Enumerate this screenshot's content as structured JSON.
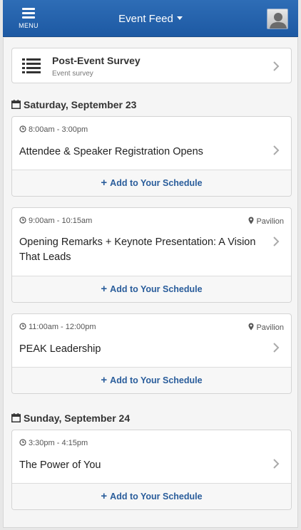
{
  "header": {
    "menu_label": "MENU",
    "feed_title": "Event Feed"
  },
  "survey": {
    "title": "Post-Event Survey",
    "subtitle": "Event survey"
  },
  "days": [
    {
      "label": "Saturday, September 23",
      "sessions": [
        {
          "time": "8:00am - 3:00pm",
          "location": "",
          "title": "Attendee & Speaker Registration Opens",
          "add_label": "Add to Your Schedule"
        },
        {
          "time": "9:00am - 10:15am",
          "location": "Pavilion",
          "title": "Opening Remarks + Keynote Presentation: A Vision That Leads",
          "add_label": "Add to Your Schedule"
        },
        {
          "time": "11:00am - 12:00pm",
          "location": "Pavilion",
          "title": "PEAK Leadership",
          "add_label": "Add to Your Schedule"
        }
      ]
    },
    {
      "label": "Sunday, September 24",
      "sessions": [
        {
          "time": "3:30pm - 4:15pm",
          "location": "",
          "title": "The Power of You",
          "add_label": "Add to Your Schedule"
        }
      ]
    }
  ],
  "colors": {
    "header": "#2166b0",
    "link": "#2a5d9b"
  },
  "icons": {
    "menu": "hamburger-icon",
    "dropdown": "caret-down-icon",
    "avatar": "user-avatar-icon",
    "survey": "list-icon",
    "day": "calendar-icon",
    "time": "clock-icon",
    "location": "map-marker-icon",
    "chevron": "chevron-right-icon",
    "add": "plus-icon"
  }
}
